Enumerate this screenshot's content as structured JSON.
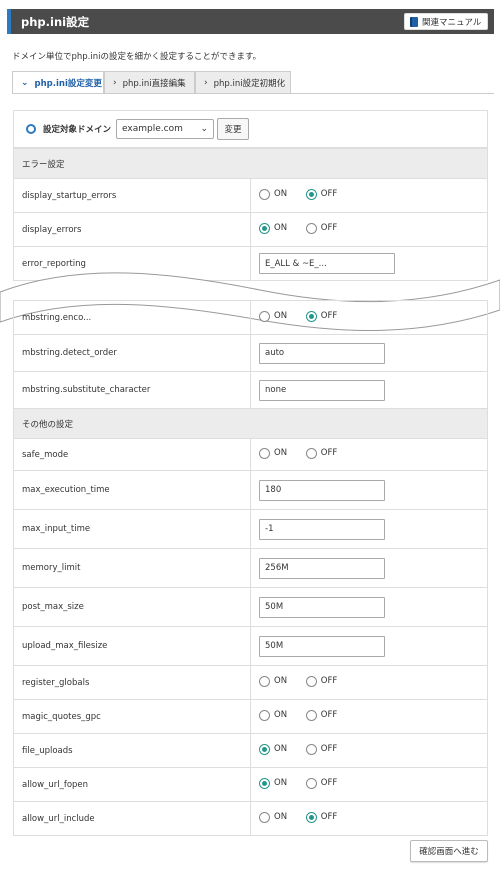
{
  "header": {
    "title": "php.ini設定",
    "manual_button": "関連マニュアル"
  },
  "description": "ドメイン単位でphp.iniの設定を細かく設定することができます。",
  "tabs": [
    {
      "label": "php.ini設定変更",
      "active": true
    },
    {
      "label": "php.ini直接編集",
      "active": false
    },
    {
      "label": "php.ini設定初期化",
      "active": false
    }
  ],
  "domain": {
    "label": "設定対象ドメイン",
    "selected": "example.com",
    "change_button": "変更"
  },
  "options": {
    "on": "ON",
    "off": "OFF"
  },
  "sections": {
    "error": "エラー設定",
    "other": "その他の設定"
  },
  "top_rows": [
    {
      "name": "display_startup_errors",
      "type": "radio",
      "value": "OFF"
    },
    {
      "name": "display_errors",
      "type": "radio",
      "value": "ON"
    },
    {
      "name": "error_reporting",
      "type": "text",
      "value": "E_ALL & ~E_..."
    }
  ],
  "mb_rows": [
    {
      "name": "mbstring.enco...",
      "type": "radio",
      "value": "OFF"
    },
    {
      "name": "mbstring.detect_order",
      "type": "text",
      "value": "auto"
    },
    {
      "name": "mbstring.substitute_character",
      "type": "text",
      "value": "none"
    }
  ],
  "other_rows": [
    {
      "name": "safe_mode",
      "type": "radio",
      "value": "none"
    },
    {
      "name": "max_execution_time",
      "type": "text",
      "value": "180"
    },
    {
      "name": "max_input_time",
      "type": "text",
      "value": "-1"
    },
    {
      "name": "memory_limit",
      "type": "text",
      "value": "256M"
    },
    {
      "name": "post_max_size",
      "type": "text",
      "value": "50M"
    },
    {
      "name": "upload_max_filesize",
      "type": "text",
      "value": "50M"
    },
    {
      "name": "register_globals",
      "type": "radio",
      "value": "none"
    },
    {
      "name": "magic_quotes_gpc",
      "type": "radio",
      "value": "none"
    },
    {
      "name": "file_uploads",
      "type": "radio",
      "value": "ON"
    },
    {
      "name": "allow_url_fopen",
      "type": "radio",
      "value": "ON"
    },
    {
      "name": "allow_url_include",
      "type": "radio",
      "value": "OFF"
    }
  ],
  "confirm_button": "確認画面へ進む",
  "colors": {
    "header_bg": "#4b4b4b",
    "accent_blue": "#2e7ac1",
    "radio_checked": "#25978a",
    "section_bg": "#ececec"
  }
}
